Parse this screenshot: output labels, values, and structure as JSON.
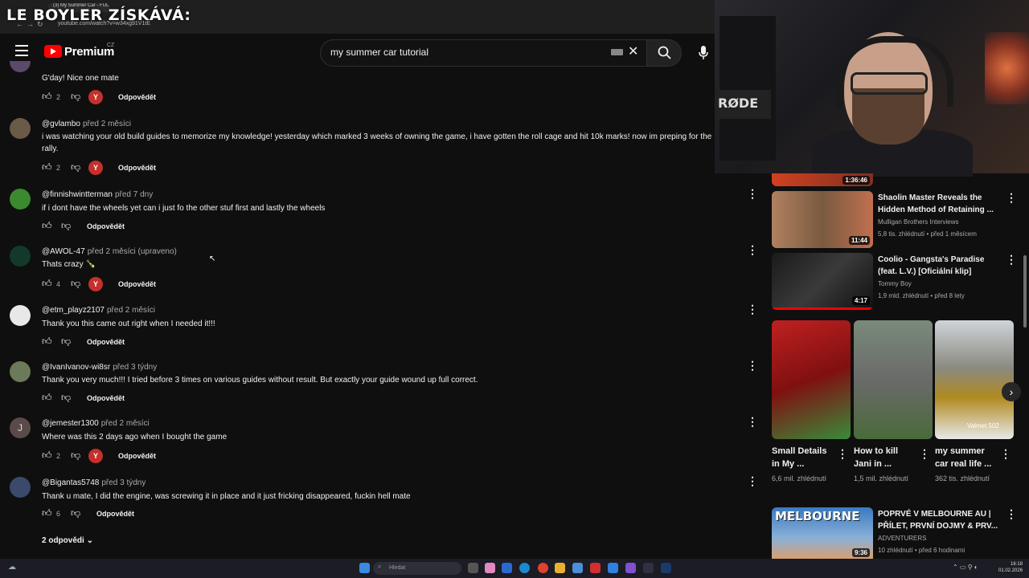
{
  "overlay": {
    "text": "LE BOYLER ZÍSKÁVÁ:"
  },
  "browser": {
    "tab_title": "(3) My Summer Car - FULL Car...",
    "url": "youtube.com/watch?v=w34xg91V1tE"
  },
  "header": {
    "logo_text": "Premium",
    "country": "CZ",
    "search_value": "my summer car tutorial"
  },
  "comments": [
    {
      "author": "",
      "time": "",
      "text": "G'day! Nice one mate",
      "likes": "2",
      "heart": true,
      "reply": "Odpovědět"
    },
    {
      "author": "@gvlambo",
      "time": "před 2 měsíci",
      "text": "i was watching your old build guides to memorize my knowledge! yesterday which marked 3 weeks of owning the game, i have gotten the roll cage and hit 10k marks! now im preping for the rally.",
      "likes": "2",
      "heart": true,
      "reply": "Odpovědět"
    },
    {
      "author": "@finnishwintterman",
      "time": "před 7 dny",
      "text": "if i dont have the wheels yet can i just fo the other stuf first and lastly the wheels",
      "likes": "",
      "heart": false,
      "reply": "Odpovědět"
    },
    {
      "author": "@AWOL-47",
      "time": "před 2 měsíci (upraveno)",
      "text": "Thats crazy 🍾",
      "likes": "4",
      "heart": true,
      "reply": "Odpovědět"
    },
    {
      "author": "@etm_playz2107",
      "time": "před 2 měsíci",
      "text": "Thank you this came out right when I needed it!!!",
      "likes": "",
      "heart": false,
      "reply": "Odpovědět"
    },
    {
      "author": "@IvanIvanov-wi8sr",
      "time": "před 3 týdny",
      "text": "Thank you very much!!! I tried before 3 times on various guides without result. But exactly your guide wound up full correct.",
      "likes": "",
      "heart": false,
      "reply": "Odpovědět"
    },
    {
      "author": "@jemester1300",
      "time": "před 2 měsíci",
      "text": "Where was this 2 days ago when I bought the game",
      "likes": "2",
      "heart": true,
      "reply": "Odpovědět"
    },
    {
      "author": "@Bigantas5748",
      "time": "před 3 týdny",
      "text": "Thank u mate, I did the engine, was screwing it in place and it just fricking disappeared, fuckin hell mate",
      "likes": "6",
      "heart": false,
      "reply": "Odpovědět"
    }
  ],
  "more_replies": "2 odpovědi",
  "avatar_letter": "J",
  "webcam": {
    "mic_brand": "RØDE"
  },
  "sidebar": {
    "top_duration": "1:36:46",
    "videos": [
      {
        "title": "Shaolin Master Reveals the Hidden Method of Retaining ...",
        "channel": "Mulligan Brothers Interviews",
        "meta": "5,8 tis. zhlédnutí • před 1 měsícem",
        "duration": "11:44"
      },
      {
        "title": "Coolio - Gangsta's Paradise (feat. L.V.) [Oficiální klip]",
        "channel": "Tommy Boy",
        "meta": "1,9 mld. zhlédnutí • před 8 lety",
        "duration": "4:17"
      }
    ],
    "shorts": [
      {
        "title": "Small Details in My ...",
        "views": "6,6 mil. zhlédnutí"
      },
      {
        "title": "How to kill Jani in ...",
        "views": "1,5 mil. zhlédnutí"
      },
      {
        "title": "my summer car real life ...",
        "views": "362 tis. zhlédnutí"
      }
    ],
    "short3_caption": "Valmet 502",
    "bottom_video": {
      "title": "POPRVÉ V MELBOURNE AU | PŘÍLET, PRVNÍ DOJMY & PRV...",
      "channel": "ADVENTURERS",
      "meta": "10 zhlédnutí • před 6 hodinami",
      "duration": "9:36",
      "thumb_text": "MELBOURNE"
    }
  },
  "taskbar": {
    "search_placeholder": "Hledat",
    "time": "16:18",
    "date": "01.02.2026"
  },
  "colors": {
    "accent": "#ff0000",
    "heart": "#c4302b",
    "bg": "#0f0f0f"
  }
}
